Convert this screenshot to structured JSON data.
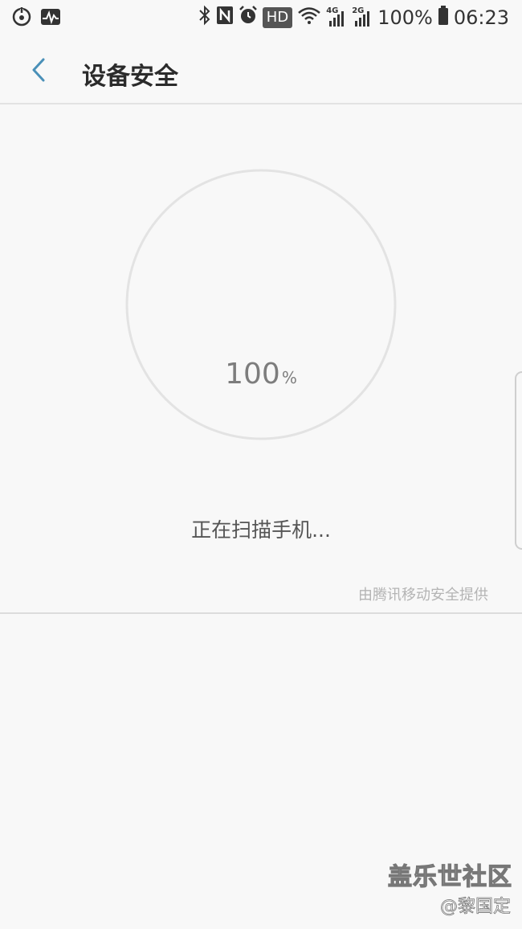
{
  "status_bar": {
    "battery_percent": "100%",
    "time": "06:23",
    "hd_badge": "HD",
    "network_4g": "4G",
    "network_2g": "2G",
    "icons": [
      "sync-icon",
      "activity-icon",
      "bluetooth-icon",
      "nfc-icon",
      "alarm-icon",
      "hd-icon",
      "wifi-icon",
      "signal-4g-icon",
      "signal-2g-icon",
      "battery-icon"
    ]
  },
  "header": {
    "title": "设备安全",
    "back_icon": "chevron-left-icon",
    "accent_color": "#4a90b8"
  },
  "scan": {
    "progress_number": "100",
    "progress_unit": "%",
    "status_text": "正在扫描手机...",
    "provider": "由腾讯移动安全提供",
    "ring_color": "#e3e3e3"
  },
  "watermark": {
    "title": "盖乐世社区",
    "author": "@黎国定"
  }
}
